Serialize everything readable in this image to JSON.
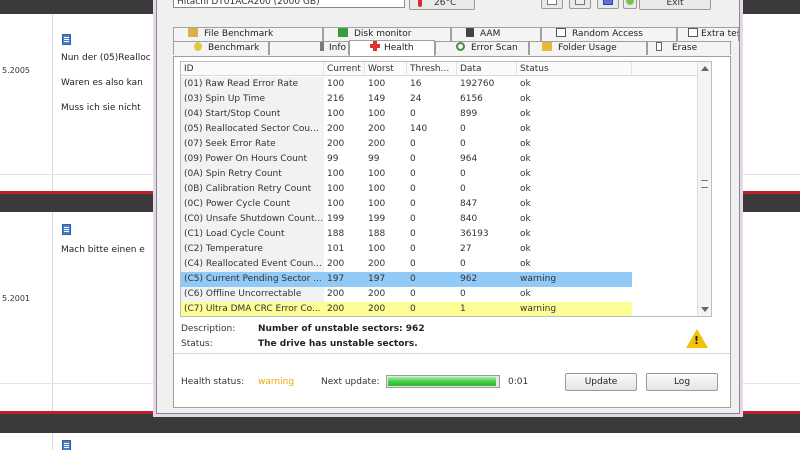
{
  "background_forum": {
    "posts": [
      {
        "date": "5.2005",
        "lines": [
          "Nun der (05)Realloc",
          "Waren es also kan",
          "Muss ich sie nicht"
        ]
      },
      {
        "date": "5.2001",
        "lines": [
          "Mach bitte einen e"
        ]
      }
    ]
  },
  "toolbar": {
    "drive_select_value": "Hitachi DT01ACA200 (2000 GB)",
    "temperature": "26°C",
    "exit_label": "Exit"
  },
  "tabs_row1": [
    {
      "label": "File Benchmark",
      "icon": "file-benchmark-icon"
    },
    {
      "label": "Disk monitor",
      "icon": "disk-monitor-icon"
    },
    {
      "label": "AAM",
      "icon": "speaker-icon"
    },
    {
      "label": "Random Access",
      "icon": "random-access-icon"
    },
    {
      "label": "Extra tests",
      "icon": "extra-tests-icon"
    }
  ],
  "tabs_row2": [
    {
      "label": "Benchmark",
      "icon": "benchmark-icon"
    },
    {
      "label": "Info",
      "icon": "info-icon"
    },
    {
      "label": "Health",
      "icon": "health-cross-icon"
    },
    {
      "label": "Error Scan",
      "icon": "magnifier-icon"
    },
    {
      "label": "Folder Usage",
      "icon": "folder-icon"
    },
    {
      "label": "Erase",
      "icon": "erase-icon"
    }
  ],
  "table": {
    "columns": [
      "ID",
      "Current",
      "Worst",
      "Thresh...",
      "Data",
      "Status"
    ],
    "rows": [
      {
        "id": "(01) Raw Read Error Rate",
        "current": "100",
        "worst": "100",
        "threshold": "16",
        "data": "192760",
        "status": "ok",
        "highlight": ""
      },
      {
        "id": "(03) Spin Up Time",
        "current": "216",
        "worst": "149",
        "threshold": "24",
        "data": "6156",
        "status": "ok",
        "highlight": ""
      },
      {
        "id": "(04) Start/Stop Count",
        "current": "100",
        "worst": "100",
        "threshold": "0",
        "data": "899",
        "status": "ok",
        "highlight": ""
      },
      {
        "id": "(05) Reallocated Sector Cou...",
        "current": "200",
        "worst": "200",
        "threshold": "140",
        "data": "0",
        "status": "ok",
        "highlight": ""
      },
      {
        "id": "(07) Seek Error Rate",
        "current": "200",
        "worst": "200",
        "threshold": "0",
        "data": "0",
        "status": "ok",
        "highlight": ""
      },
      {
        "id": "(09) Power On Hours Count",
        "current": "99",
        "worst": "99",
        "threshold": "0",
        "data": "964",
        "status": "ok",
        "highlight": ""
      },
      {
        "id": "(0A) Spin Retry Count",
        "current": "100",
        "worst": "100",
        "threshold": "0",
        "data": "0",
        "status": "ok",
        "highlight": ""
      },
      {
        "id": "(0B) Calibration Retry Count",
        "current": "100",
        "worst": "100",
        "threshold": "0",
        "data": "0",
        "status": "ok",
        "highlight": ""
      },
      {
        "id": "(0C) Power Cycle Count",
        "current": "100",
        "worst": "100",
        "threshold": "0",
        "data": "847",
        "status": "ok",
        "highlight": ""
      },
      {
        "id": "(C0) Unsafe Shutdown Count...",
        "current": "199",
        "worst": "199",
        "threshold": "0",
        "data": "840",
        "status": "ok",
        "highlight": ""
      },
      {
        "id": "(C1) Load Cycle Count",
        "current": "188",
        "worst": "188",
        "threshold": "0",
        "data": "36193",
        "status": "ok",
        "highlight": ""
      },
      {
        "id": "(C2) Temperature",
        "current": "101",
        "worst": "100",
        "threshold": "0",
        "data": "27",
        "status": "ok",
        "highlight": ""
      },
      {
        "id": "(C4) Reallocated Event Coun...",
        "current": "200",
        "worst": "200",
        "threshold": "0",
        "data": "0",
        "status": "ok",
        "highlight": ""
      },
      {
        "id": "(C5) Current Pending Sector ...",
        "current": "197",
        "worst": "197",
        "threshold": "0",
        "data": "962",
        "status": "warning",
        "highlight": "blue"
      },
      {
        "id": "(C6) Offline Uncorrectable",
        "current": "200",
        "worst": "200",
        "threshold": "0",
        "data": "0",
        "status": "ok",
        "highlight": ""
      },
      {
        "id": "(C7) Ultra DMA CRC Error Co...",
        "current": "200",
        "worst": "200",
        "threshold": "0",
        "data": "1",
        "status": "warning",
        "highlight": "yellow"
      }
    ]
  },
  "details": {
    "description_label": "Description:",
    "description_value": "Number of unstable sectors: 962",
    "status_label": "Status:",
    "status_value": "The drive has unstable sectors."
  },
  "footer": {
    "health_status_label": "Health status:",
    "health_status_value": "warning",
    "next_update_label": "Next update:",
    "next_update_progress": 0.98,
    "next_update_value": "0:01",
    "update_button": "Update",
    "log_button": "Log"
  },
  "colors": {
    "warning_text": "#f0a800",
    "highlight_blue": "#91c9f7",
    "highlight_yellow": "#fdfd96",
    "progress_green": "#3fcd3f"
  }
}
